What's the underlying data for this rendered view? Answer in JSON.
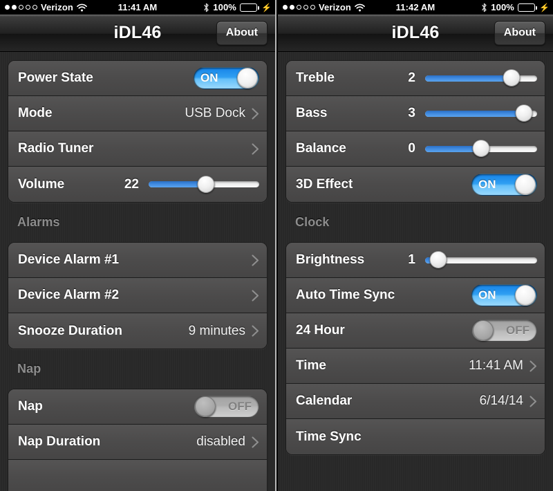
{
  "left": {
    "statusbar": {
      "carrier": "Verizon",
      "signal_filled": 2,
      "signal_total": 5,
      "wifi_icon": "wifi-icon",
      "time": "11:41 AM",
      "bluetooth_icon": "bluetooth-icon",
      "battery_percent": "100%",
      "battery_charging_icon": "lightning-bolt-icon"
    },
    "navbar": {
      "title": "iDL46",
      "about_label": "About"
    },
    "groups": [
      {
        "header": null,
        "rows": [
          {
            "name": "power-state",
            "label": "Power State",
            "type": "toggle",
            "state": "ON"
          },
          {
            "name": "mode",
            "label": "Mode",
            "type": "disclosure",
            "value": "USB Dock"
          },
          {
            "name": "radio-tuner",
            "label": "Radio Tuner",
            "type": "disclosure",
            "value": ""
          },
          {
            "name": "volume",
            "label": "Volume",
            "type": "slider",
            "value": "22",
            "percent": 52
          }
        ]
      },
      {
        "header": "Alarms",
        "rows": [
          {
            "name": "device-alarm-1",
            "label": "Device Alarm #1",
            "type": "disclosure",
            "value": ""
          },
          {
            "name": "device-alarm-2",
            "label": "Device Alarm #2",
            "type": "disclosure",
            "value": ""
          },
          {
            "name": "snooze-duration",
            "label": "Snooze Duration",
            "type": "disclosure",
            "value": "9 minutes"
          }
        ]
      },
      {
        "header": "Nap",
        "clipped": true,
        "rows": [
          {
            "name": "nap",
            "label": "Nap",
            "type": "toggle",
            "state": "OFF"
          },
          {
            "name": "nap-duration",
            "label": "Nap Duration",
            "type": "disclosure",
            "value": "disabled"
          },
          {
            "name": "nap-partial-row",
            "label": "",
            "type": "blank",
            "value": ""
          }
        ]
      }
    ]
  },
  "right": {
    "statusbar": {
      "carrier": "Verizon",
      "signal_filled": 2,
      "signal_total": 5,
      "wifi_icon": "wifi-icon",
      "time": "11:42 AM",
      "bluetooth_icon": "bluetooth-icon",
      "battery_percent": "100%",
      "battery_charging_icon": "lightning-bolt-icon"
    },
    "navbar": {
      "title": "iDL46",
      "about_label": "About"
    },
    "groups": [
      {
        "header": null,
        "rows": [
          {
            "name": "treble",
            "label": "Treble",
            "type": "slider",
            "value": "2",
            "percent": 77
          },
          {
            "name": "bass",
            "label": "Bass",
            "type": "slider",
            "value": "3",
            "percent": 88
          },
          {
            "name": "balance",
            "label": "Balance",
            "type": "slider",
            "value": "0",
            "percent": 50
          },
          {
            "name": "3d-effect",
            "label": "3D Effect",
            "type": "toggle",
            "state": "ON"
          }
        ]
      },
      {
        "header": "Clock",
        "rows": [
          {
            "name": "brightness",
            "label": "Brightness",
            "type": "slider",
            "value": "1",
            "percent": 12
          },
          {
            "name": "auto-time-sync",
            "label": "Auto Time Sync",
            "type": "toggle",
            "state": "ON"
          },
          {
            "name": "24-hour",
            "label": "24 Hour",
            "type": "toggle",
            "state": "OFF"
          },
          {
            "name": "time",
            "label": "Time",
            "type": "disclosure",
            "value": "11:41 AM"
          },
          {
            "name": "calendar",
            "label": "Calendar",
            "type": "disclosure",
            "value": "6/14/14"
          },
          {
            "name": "time-sync",
            "label": "Time Sync",
            "type": "plain",
            "value": ""
          }
        ]
      }
    ]
  },
  "colors": {
    "accent_blue": "#3f8ae0",
    "toggle_on": "#2f9ff2",
    "battery_green": "#44dd4b",
    "row_bg": "#4c4b4b",
    "page_bg": "#282828",
    "section_header": "#8d8d8d"
  }
}
